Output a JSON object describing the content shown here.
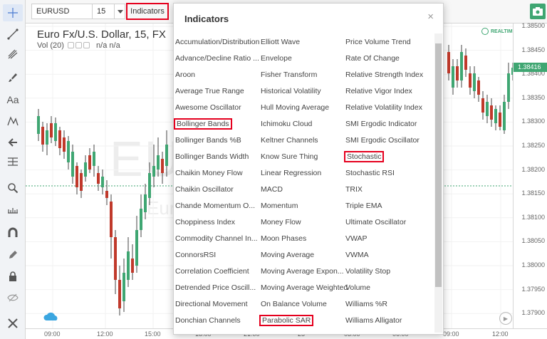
{
  "toolbar": {
    "symbol": "EURUSD",
    "interval": "15",
    "indicators_label": "Indicators"
  },
  "chart": {
    "title": "Euro Fx/U.S. Dollar, 15, FX",
    "volume_label": "Vol (20)",
    "volume_values": "n/a  n/a",
    "watermark_symbol": "EUR",
    "watermark_name": "Eur",
    "realtime_label": "REALTIME",
    "current_price": "1.38416",
    "price_ticks": [
      "1.38500",
      "1.38450",
      "1.38400",
      "1.38350",
      "1.38300",
      "1.38250",
      "1.38200",
      "1.38150",
      "1.38100",
      "1.38050",
      "1.38000",
      "1.37950",
      "1.37900"
    ],
    "time_ticks": [
      "09:00",
      "12:00",
      "15:00",
      "18:00",
      "21:00",
      "25",
      "03:00",
      "06:00",
      "09:00",
      "12:00"
    ],
    "colors": {
      "up": "#3fa672",
      "down": "#c0392b",
      "highlight": "#e5001e"
    }
  },
  "dialog": {
    "title": "Indicators",
    "close_label": "×",
    "columns": [
      [
        "Accumulation/Distribution",
        "Advance/Decline Ratio ...",
        "Aroon",
        "Average True Range",
        "Awesome Oscillator",
        "Bollinger Bands",
        "Bollinger Bands %B",
        "Bollinger Bands Width",
        "Chaikin Money Flow",
        "Chaikin Oscillator",
        "Chande Momentum O...",
        "Choppiness Index",
        "Commodity Channel In...",
        "ConnorsRSI",
        "Correlation Coefficient",
        "Detrended Price Oscill...",
        "Directional Movement",
        "Donchian Channels"
      ],
      [
        "Elliott Wave",
        "Envelope",
        "Fisher Transform",
        "Historical Volatility",
        "Hull Moving Average",
        "Ichimoku Cloud",
        "Keltner Channels",
        "Know Sure Thing",
        "Linear Regression",
        "MACD",
        "Momentum",
        "Money Flow",
        "Moon Phases",
        "Moving Average",
        "Moving Average Expon...",
        "Moving Average Weighted",
        "On Balance Volume",
        "Parabolic SAR"
      ],
      [
        "Price Volume Trend",
        "Rate Of Change",
        "Relative Strength Index",
        "Relative Vigor Index",
        "Relative Volatility Index",
        "SMI Ergodic Indicator",
        "SMI Ergodic Oscillator",
        "Stochastic",
        "Stochastic RSI",
        "TRIX",
        "Triple EMA",
        "Ultimate Oscillator",
        "VWAP",
        "VWMA",
        "Volatility Stop",
        "Volume",
        "Williams %R",
        "Williams Alligator"
      ]
    ],
    "highlighted": [
      "Bollinger Bands",
      "Stochastic",
      "Parabolic SAR"
    ]
  },
  "left_tools": [
    "crosshair-icon",
    "trend-line-icon",
    "pitchfork-icon",
    "brush-icon",
    "text-icon",
    "pattern-icon",
    "arrow-left-icon",
    "fib-icon",
    "zoom-icon",
    "measure-icon",
    "magnet-icon",
    "pencil-icon",
    "lock-icon",
    "eye-hidden-icon",
    "trash-icon"
  ]
}
